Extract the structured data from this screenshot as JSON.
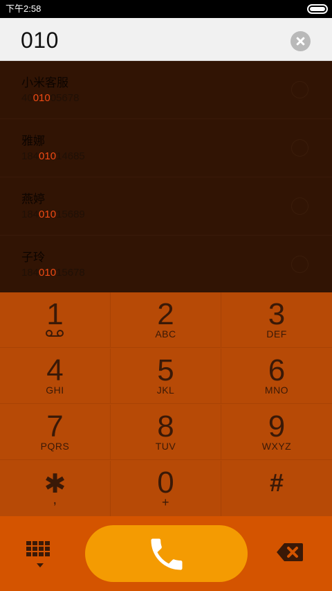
{
  "status_bar": {
    "time": "下午2:58"
  },
  "input": {
    "value": "010"
  },
  "results": [
    {
      "name": "小米客服",
      "number_prefix": "40",
      "number_match": "010",
      "number_suffix": "05678"
    },
    {
      "name": "雅娜",
      "number_prefix": "184",
      "number_match": "010",
      "number_suffix": "14685"
    },
    {
      "name": "燕婷",
      "number_prefix": "184",
      "number_match": "010",
      "number_suffix": "15689"
    },
    {
      "name": "子玲",
      "number_prefix": "184",
      "number_match": "010",
      "number_suffix": "15678"
    }
  ],
  "keypad": [
    {
      "digit": "1",
      "letters": "",
      "icon": "voicemail-icon"
    },
    {
      "digit": "2",
      "letters": "ABC"
    },
    {
      "digit": "3",
      "letters": "DEF"
    },
    {
      "digit": "4",
      "letters": "GHI"
    },
    {
      "digit": "5",
      "letters": "JKL"
    },
    {
      "digit": "6",
      "letters": "MNO"
    },
    {
      "digit": "7",
      "letters": "PQRS"
    },
    {
      "digit": "8",
      "letters": "TUV"
    },
    {
      "digit": "9",
      "letters": "WXYZ"
    },
    {
      "digit": "✱",
      "letters": ","
    },
    {
      "digit": "0",
      "letters": "+"
    },
    {
      "digit": "#",
      "letters": ""
    }
  ],
  "actions": {
    "dialpad_icon": "dialpad-grid-icon",
    "call_icon": "phone-icon",
    "backspace_icon": "backspace-icon"
  },
  "colors": {
    "results_bg": "#311404",
    "keypad_bg": "#b74a06",
    "action_bar_bg": "#d45400",
    "call_button": "#f49b02",
    "highlight": "#ef4a14"
  }
}
